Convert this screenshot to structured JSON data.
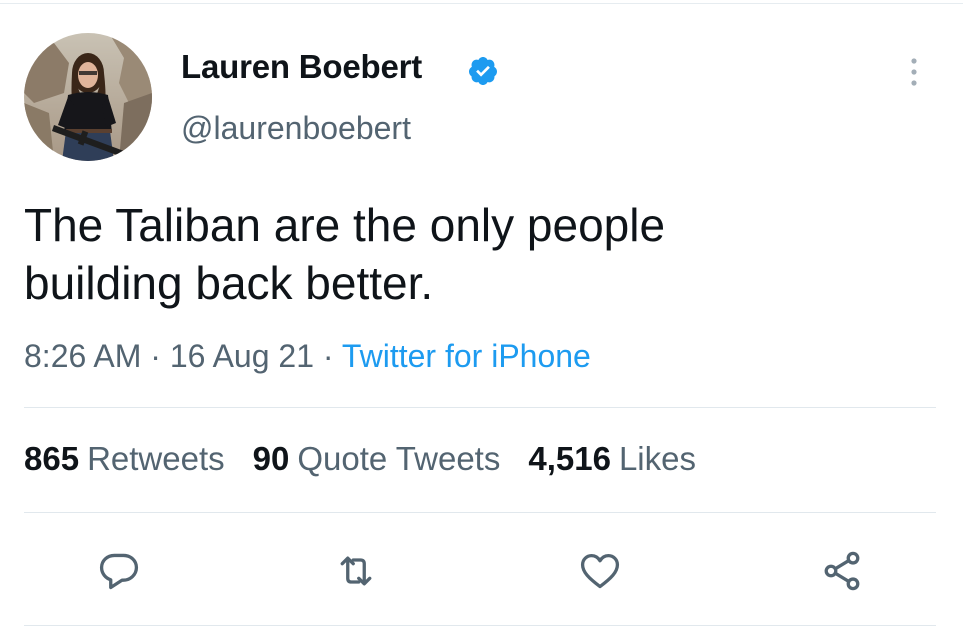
{
  "user": {
    "display_name": "Lauren Boebert",
    "handle": "@laurenboebert",
    "verified": true
  },
  "tweet": {
    "text_line_1": "The Taliban are the only people",
    "text_line_2": "building back better.",
    "time": "8:26 AM",
    "date": "16 Aug 21",
    "separator": "·",
    "source": "Twitter for iPhone"
  },
  "stats": {
    "retweets_count": "865",
    "retweets_label": "Retweets",
    "quotes_count": "90",
    "quotes_label": "Quote Tweets",
    "likes_count": "4,516",
    "likes_label": "Likes"
  },
  "icons": {
    "verified": "verified-badge-icon",
    "more": "more-vertical-icon",
    "reply": "reply-icon",
    "retweet": "retweet-icon",
    "like": "heart-icon",
    "share": "share-icon"
  },
  "colors": {
    "text": "#0f1419",
    "secondary": "#536471",
    "accent": "#1d9bf0",
    "divider": "#e1e8ed"
  }
}
